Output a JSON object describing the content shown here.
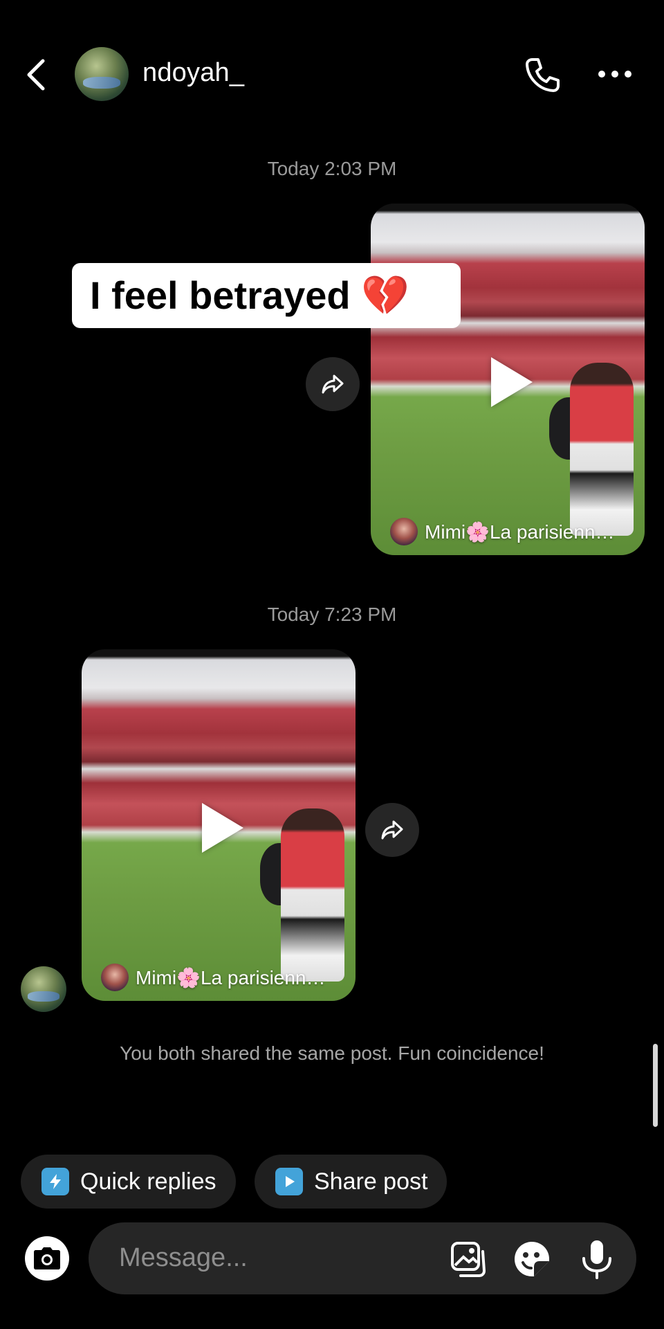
{
  "header": {
    "username": "ndoyah_",
    "icons": [
      "back-chevron-icon",
      "avatar",
      "phone-icon",
      "more-icon"
    ]
  },
  "messages": [
    {
      "timestamp": "Today 2:03 PM",
      "side": "right",
      "type": "shared-video",
      "author": "Mimi🌸La parisienn…"
    },
    {
      "timestamp": "Today 7:23 PM",
      "side": "left",
      "type": "shared-video",
      "author": "Mimi🌸La parisienn…"
    }
  ],
  "overlay_caption": "I feel betrayed 💔",
  "system_note": "You both shared the same post. Fun coincidence!",
  "chips": {
    "quick_replies": "Quick replies",
    "share_post": "Share post"
  },
  "composer": {
    "placeholder": "Message..."
  },
  "colors": {
    "background": "#000000",
    "chip_icon": "#43a3d9",
    "bubble_bg": "#262626"
  }
}
